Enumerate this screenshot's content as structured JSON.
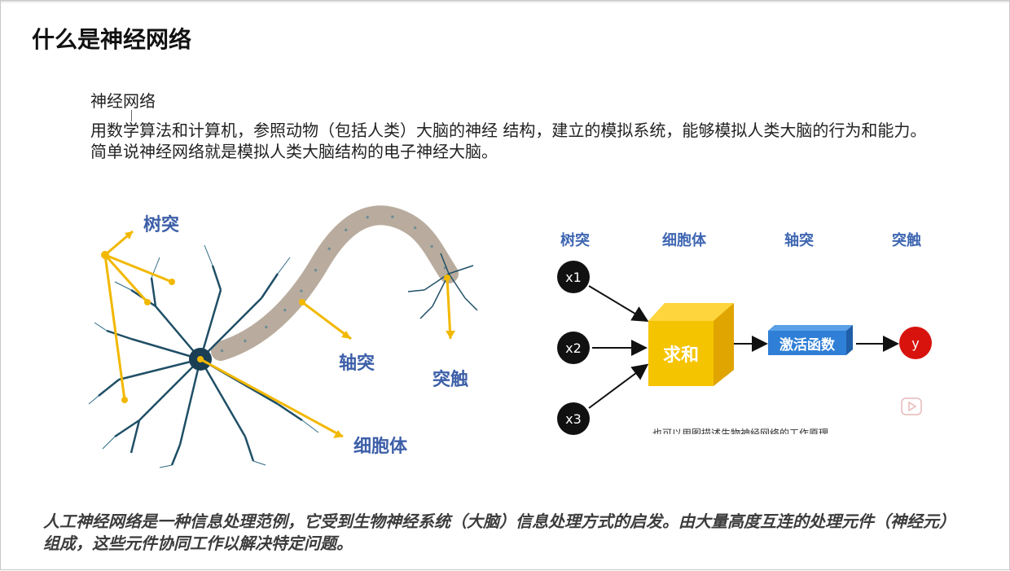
{
  "slide": {
    "title": "什么是神经网络",
    "section_heading": "神经网络",
    "paragraph": "用数学算法和计算机，参照动物（包括人类）大脑的神经 结构，建立的模拟系统，能够模拟人类大脑的行为和能力。 简单说神经网络就是模拟人类大脑结构的电子神经大脑。",
    "footer": "人工神经网络是一种信息处理范例，它受到生物神经系统（大脑）信息处理方式的启发。由大量高度互连的处理元件（神经元）组成，这些元件协同工作以解决特定问题。"
  },
  "neuron_figure": {
    "labels": {
      "dendrite": "树突",
      "axon": "轴突",
      "synapse": "突触",
      "cell_body": "细胞体"
    },
    "colors": {
      "arrow": "#f2b800",
      "label": "#3d5fa8",
      "neuron": "#1f4f66"
    }
  },
  "model_figure": {
    "column_headers": [
      "树突",
      "细胞体",
      "轴突",
      "突触"
    ],
    "inputs": [
      "x1",
      "x2",
      "x3"
    ],
    "sum_label": "求和",
    "activation_label": "激活函数",
    "output": "y",
    "caption": "也可以用图描述生物神经网络的工作原理",
    "colors": {
      "sum": "#f5c400",
      "activation": "#2f7fd6",
      "output": "#d8130d",
      "input": "#111111"
    }
  }
}
